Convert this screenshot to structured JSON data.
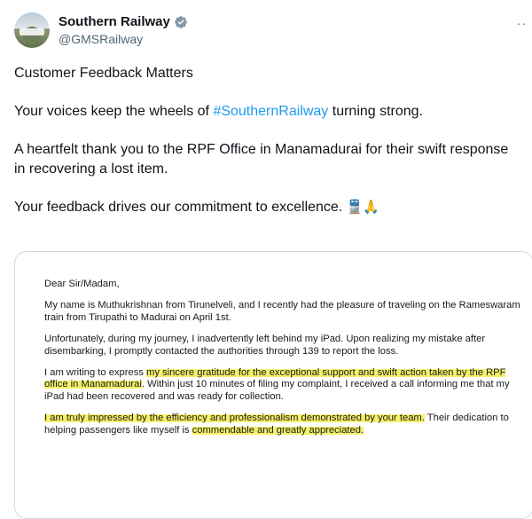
{
  "account": {
    "display_name": "Southern Railway",
    "handle": "@GMSRailway",
    "more_label": "··"
  },
  "tweet": {
    "line1": "Customer Feedback Matters",
    "line2_prefix": "Your voices keep the wheels of ",
    "hashtag": "#SouthernRailway",
    "line2_suffix": " turning strong.",
    "line3": "A heartfelt thank you to the RPF Office in Manamadurai for their swift response in recovering a lost item.",
    "line4": "Your feedback drives our commitment to excellence.",
    "emojis": "🚆🙏"
  },
  "letter": {
    "salutation": "Dear Sir/Madam,",
    "p1": "My name is Muthukrishnan from Tirunelveli, and I recently had the pleasure of traveling on the Rameswaram train from Tirupathi to Madurai on April 1st.",
    "p2": "Unfortunately, during my journey, I inadvertently left behind my iPad. Upon realizing my mistake after disembarking, I promptly contacted the authorities through 139 to report the loss.",
    "p3_a": "I am writing to express ",
    "p3_hl": "my sincere gratitude for the exceptional support and swift action taken by the RPF office in Manamadurai",
    "p3_b": ". Within just 10 minutes of filing my complaint, I received a call informing me that my iPad had been recovered and was ready for collection.",
    "p4_hl1": "I am truly impressed by the efficiency and professionalism demonstrated by your team.",
    "p4_b": " Their dedication to helping passengers like myself is ",
    "p4_hl2": "commendable and greatly appreciated.",
    "p4_end": ""
  },
  "colors": {
    "link": "#1d9bf0",
    "verified": "#829aab",
    "highlight": "#f5f06a"
  }
}
